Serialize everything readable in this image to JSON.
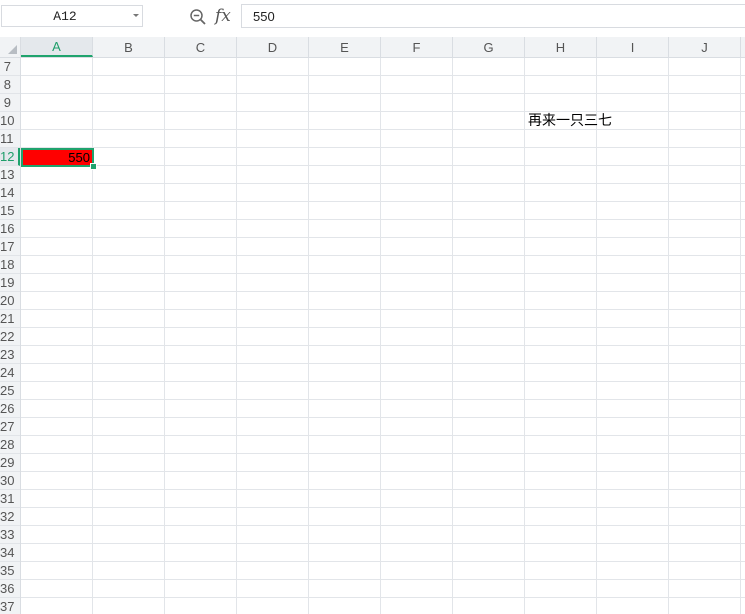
{
  "formula_bar": {
    "name_box": "A12",
    "fx_label": "fx",
    "formula_value": "550"
  },
  "columns": [
    "A",
    "B",
    "C",
    "D",
    "E",
    "F",
    "G",
    "H",
    "I",
    "J"
  ],
  "active_column": "A",
  "rows": [
    "7",
    "8",
    "9",
    "10",
    "11",
    "12",
    "13",
    "14",
    "15",
    "16",
    "17",
    "18",
    "19",
    "20",
    "21",
    "22",
    "23",
    "24",
    "25",
    "26",
    "27",
    "28",
    "29",
    "30",
    "31",
    "32",
    "33",
    "34",
    "35",
    "36",
    "37"
  ],
  "active_row": "12",
  "cells": {
    "A12": {
      "value": "550",
      "fill_color": "#ff0000"
    },
    "H10": {
      "value": "再来一只三七"
    }
  },
  "colors": {
    "selection": "#1fa36d",
    "header_bg": "#f1f3f5",
    "gridline": "#e2e5e9"
  },
  "icons": {
    "zoom": "zoom-out-icon",
    "name_box_dropdown": "chevron-down-icon"
  }
}
